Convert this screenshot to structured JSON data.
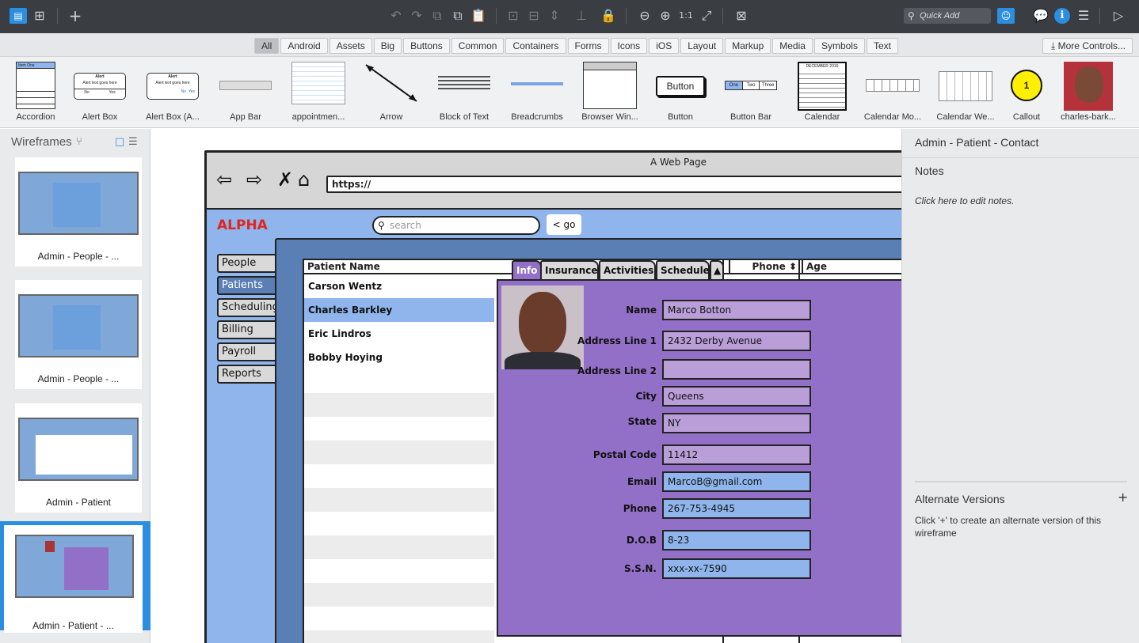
{
  "toolbar": {
    "quick_add_placeholder": "Quick Add"
  },
  "filters": [
    "All",
    "Android",
    "Assets",
    "Big",
    "Buttons",
    "Common",
    "Containers",
    "Forms",
    "Icons",
    "iOS",
    "Layout",
    "Markup",
    "Media",
    "Symbols",
    "Text"
  ],
  "more_controls": "More Controls...",
  "library": [
    {
      "label": "Accordion"
    },
    {
      "label": "Alert Box"
    },
    {
      "label": "Alert Box (A..."
    },
    {
      "label": "App Bar"
    },
    {
      "label": "appointmen..."
    },
    {
      "label": "Arrow"
    },
    {
      "label": "Block of Text"
    },
    {
      "label": "Breadcrumbs"
    },
    {
      "label": "Browser Win..."
    },
    {
      "label": "Button"
    },
    {
      "label": "Button Bar"
    },
    {
      "label": "Calendar"
    },
    {
      "label": "Calendar Mo..."
    },
    {
      "label": "Calendar We..."
    },
    {
      "label": "Callout"
    },
    {
      "label": "charles-bark..."
    }
  ],
  "library_text": {
    "accordion_item_one": "Item One",
    "alert_title": "Alert",
    "alert_text": "Alert text goes here",
    "alert_no": "No",
    "alert_yes": "Yes",
    "button_text": "Button",
    "button_bar": [
      "One",
      "Two",
      "Three"
    ],
    "calendar_month": "DECEMBER 2016",
    "callout_number": "1"
  },
  "left_panel": {
    "title": "Wireframes",
    "wireframes": [
      {
        "title": "Admin - People - ..."
      },
      {
        "title": "Admin - People - ..."
      },
      {
        "title": "Admin - Patient"
      },
      {
        "title": "Admin - Patient - ..."
      }
    ]
  },
  "mockup": {
    "browser_title": "A Web Page",
    "url": "https://",
    "brand": "ALPHA",
    "search_placeholder": "search",
    "go_label": "go",
    "nav_tabs": [
      "People",
      "Patients",
      "Scheduling",
      "Billing",
      "Payroll",
      "Reports"
    ],
    "grid_headers": {
      "name": "Patient Name",
      "phone": "Phone",
      "age": "Age"
    },
    "patients": [
      "Carson Wentz",
      "Charles Barkley",
      "Eric Lindros",
      "Bobby Hoying"
    ],
    "detail_tabs": [
      "Info",
      "Insurance",
      "Activities",
      "Schedule"
    ],
    "fields": [
      {
        "label": "Name",
        "value": "Marco Botton"
      },
      {
        "label": "Address Line 1",
        "value": "2432 Derby Avenue"
      },
      {
        "label": "Address Line 2",
        "value": ""
      },
      {
        "label": "City",
        "value": "Queens"
      },
      {
        "label": "State",
        "value": "NY"
      },
      {
        "label": "Postal Code",
        "value": "11412"
      },
      {
        "label": "Email",
        "value": "MarcoB@gmail.com"
      },
      {
        "label": "Phone",
        "value": "267-753-4945"
      },
      {
        "label": "D.O.B",
        "value": "8-23"
      },
      {
        "label": "S.S.N.",
        "value": "xxx-xx-7590"
      }
    ]
  },
  "right_panel": {
    "title": "Admin - Patient - Contact",
    "notes_title": "Notes",
    "notes_hint": "Click here to edit notes.",
    "alt_title": "Alternate Versions",
    "alt_plus": "+",
    "alt_hint": "Click '+' to create an alternate version of this wireframe"
  }
}
